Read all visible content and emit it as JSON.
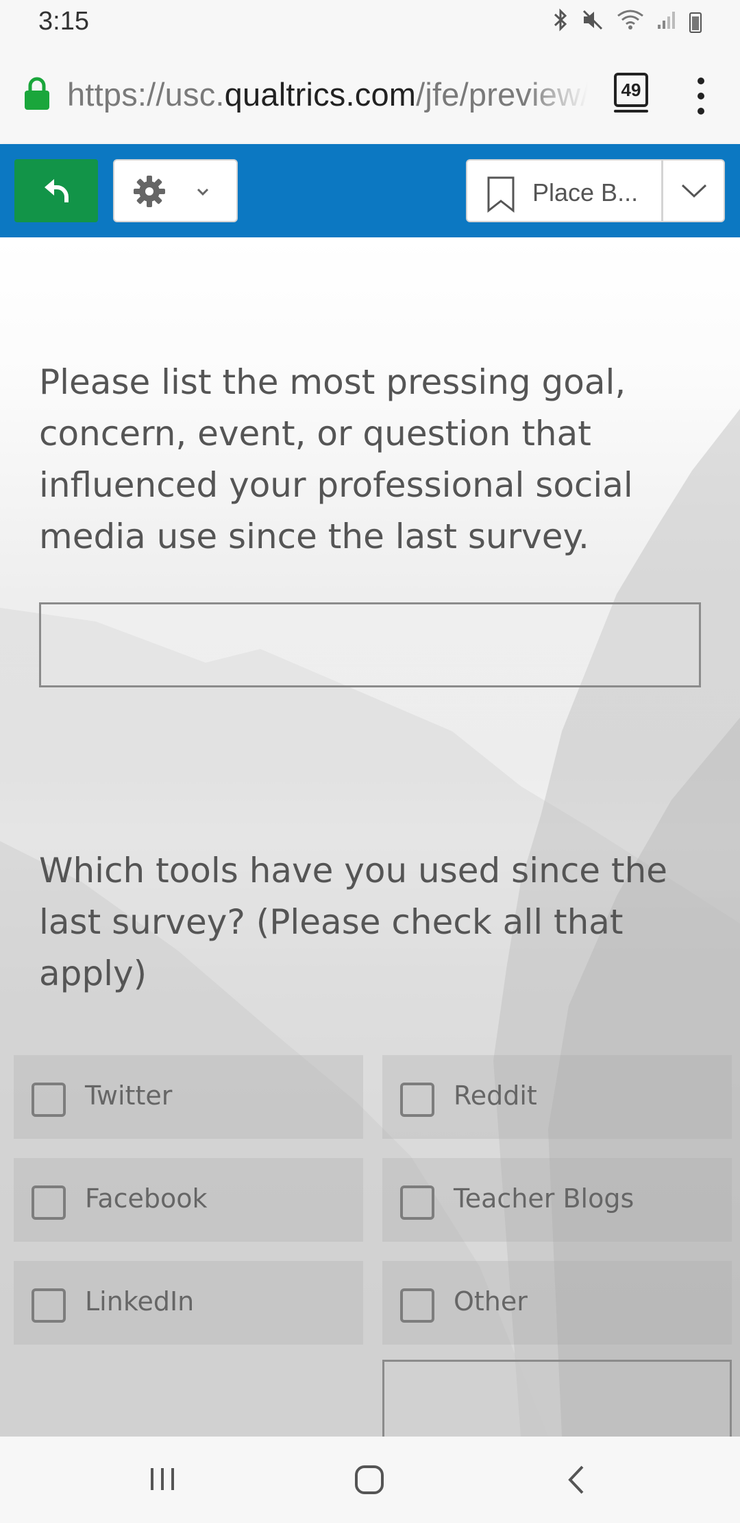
{
  "status_bar": {
    "time": "3:15",
    "icons": [
      "bluetooth-icon",
      "mute-icon",
      "wifi-icon",
      "signal-icon",
      "battery-icon"
    ]
  },
  "browser": {
    "url_prefix": "https://usc.",
    "url_host": "qualtrics.com",
    "url_path": "/jfe/preview/",
    "tab_count": "49",
    "lock_color": "#1aa63b"
  },
  "toolbar": {
    "background": "#0c78c2",
    "back_color": "#129448",
    "bookmark_label": "Place B..."
  },
  "survey": {
    "question1": "Please list the most pressing goal, concern, event, or question that influenced your professional social media use since the last survey.",
    "question2": "Which tools have you used since the last survey? (Please check all that apply)",
    "choices": [
      {
        "label": "Twitter",
        "checked": false
      },
      {
        "label": "Reddit",
        "checked": false
      },
      {
        "label": "Facebook",
        "checked": false
      },
      {
        "label": "Teacher Blogs",
        "checked": false
      },
      {
        "label": "LinkedIn",
        "checked": false
      },
      {
        "label": "Other",
        "checked": false
      }
    ]
  },
  "nav_bar": {
    "icons": [
      "recents-icon",
      "home-icon",
      "back-icon"
    ]
  }
}
